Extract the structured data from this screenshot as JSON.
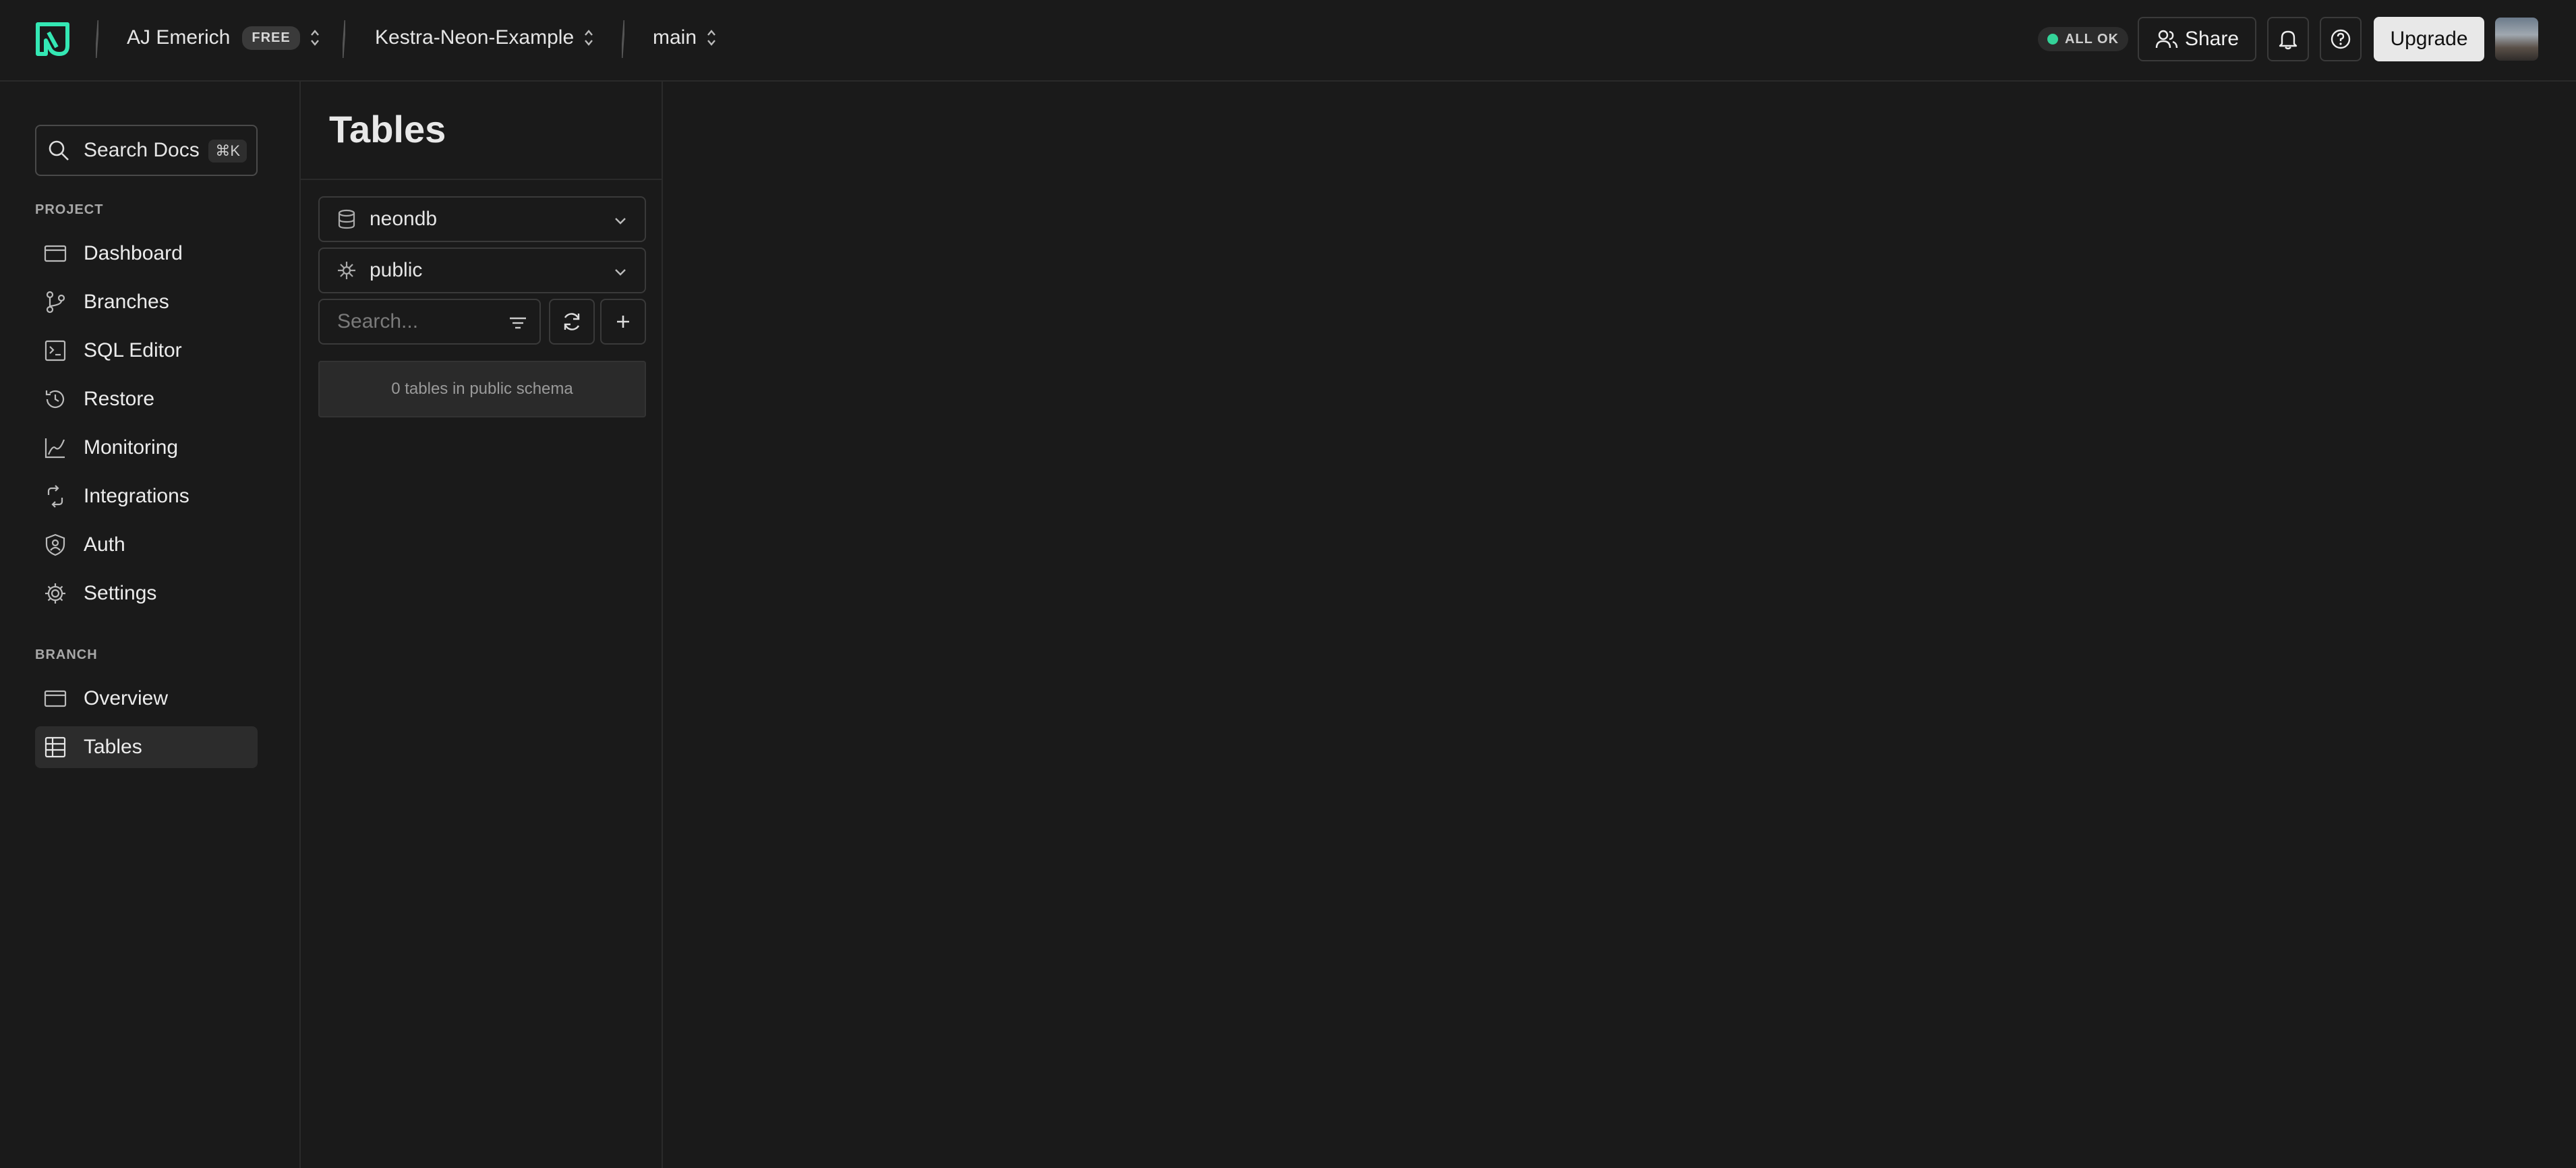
{
  "header": {
    "org_name": "AJ Emerich",
    "plan_badge": "FREE",
    "project_name": "Kestra-Neon-Example",
    "branch_name": "main",
    "status": "ALL OK",
    "share_label": "Share",
    "upgrade_label": "Upgrade",
    "accent_color": "#34d399"
  },
  "sidebar": {
    "search_label": "Search Docs",
    "search_shortcut": "⌘K",
    "project_section": "PROJECT",
    "project_items": [
      {
        "label": "Dashboard",
        "icon": "dashboard-icon"
      },
      {
        "label": "Branches",
        "icon": "branches-icon"
      },
      {
        "label": "SQL Editor",
        "icon": "sql-editor-icon"
      },
      {
        "label": "Restore",
        "icon": "restore-icon"
      },
      {
        "label": "Monitoring",
        "icon": "monitoring-icon"
      },
      {
        "label": "Integrations",
        "icon": "integrations-icon"
      },
      {
        "label": "Auth",
        "icon": "auth-icon"
      },
      {
        "label": "Settings",
        "icon": "settings-icon"
      }
    ],
    "branch_section": "BRANCH",
    "branch_items": [
      {
        "label": "Overview",
        "icon": "overview-icon"
      },
      {
        "label": "Tables",
        "icon": "tables-icon",
        "active": true
      }
    ]
  },
  "tables_panel": {
    "title": "Tables",
    "database": "neondb",
    "schema": "public",
    "search_placeholder": "Search...",
    "empty_message": "0 tables in public schema"
  }
}
